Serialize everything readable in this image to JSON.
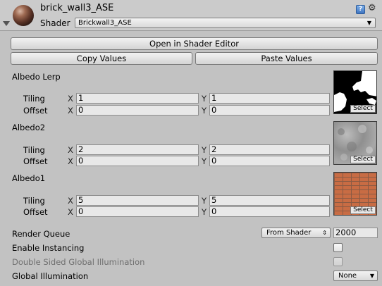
{
  "header": {
    "material_name": "brick_wall3_ASE",
    "shader_label": "Shader",
    "shader_value": "Brickwall3_ASE"
  },
  "buttons": {
    "open_shader_editor": "Open in Shader Editor",
    "copy_values": "Copy Values",
    "paste_values": "Paste Values"
  },
  "textures": [
    {
      "label": "Albedo Lerp",
      "tiling_x": "1",
      "tiling_y": "1",
      "offset_x": "0",
      "offset_y": "0"
    },
    {
      "label": "Albedo2",
      "tiling_x": "2",
      "tiling_y": "2",
      "offset_x": "0",
      "offset_y": "0"
    },
    {
      "label": "Albedo1",
      "tiling_x": "5",
      "tiling_y": "5",
      "offset_x": "0",
      "offset_y": "0"
    }
  ],
  "common": {
    "tiling": "Tiling",
    "offset": "Offset",
    "x": "X",
    "y": "Y",
    "select": "Select"
  },
  "settings": {
    "render_queue_label": "Render Queue",
    "render_queue_mode": "From Shader",
    "render_queue_value": "2000",
    "instancing_label": "Enable Instancing",
    "double_sided_gi_label": "Double Sided Global Illumination",
    "global_illumination_label": "Global Illumination",
    "global_illumination_value": "None"
  }
}
